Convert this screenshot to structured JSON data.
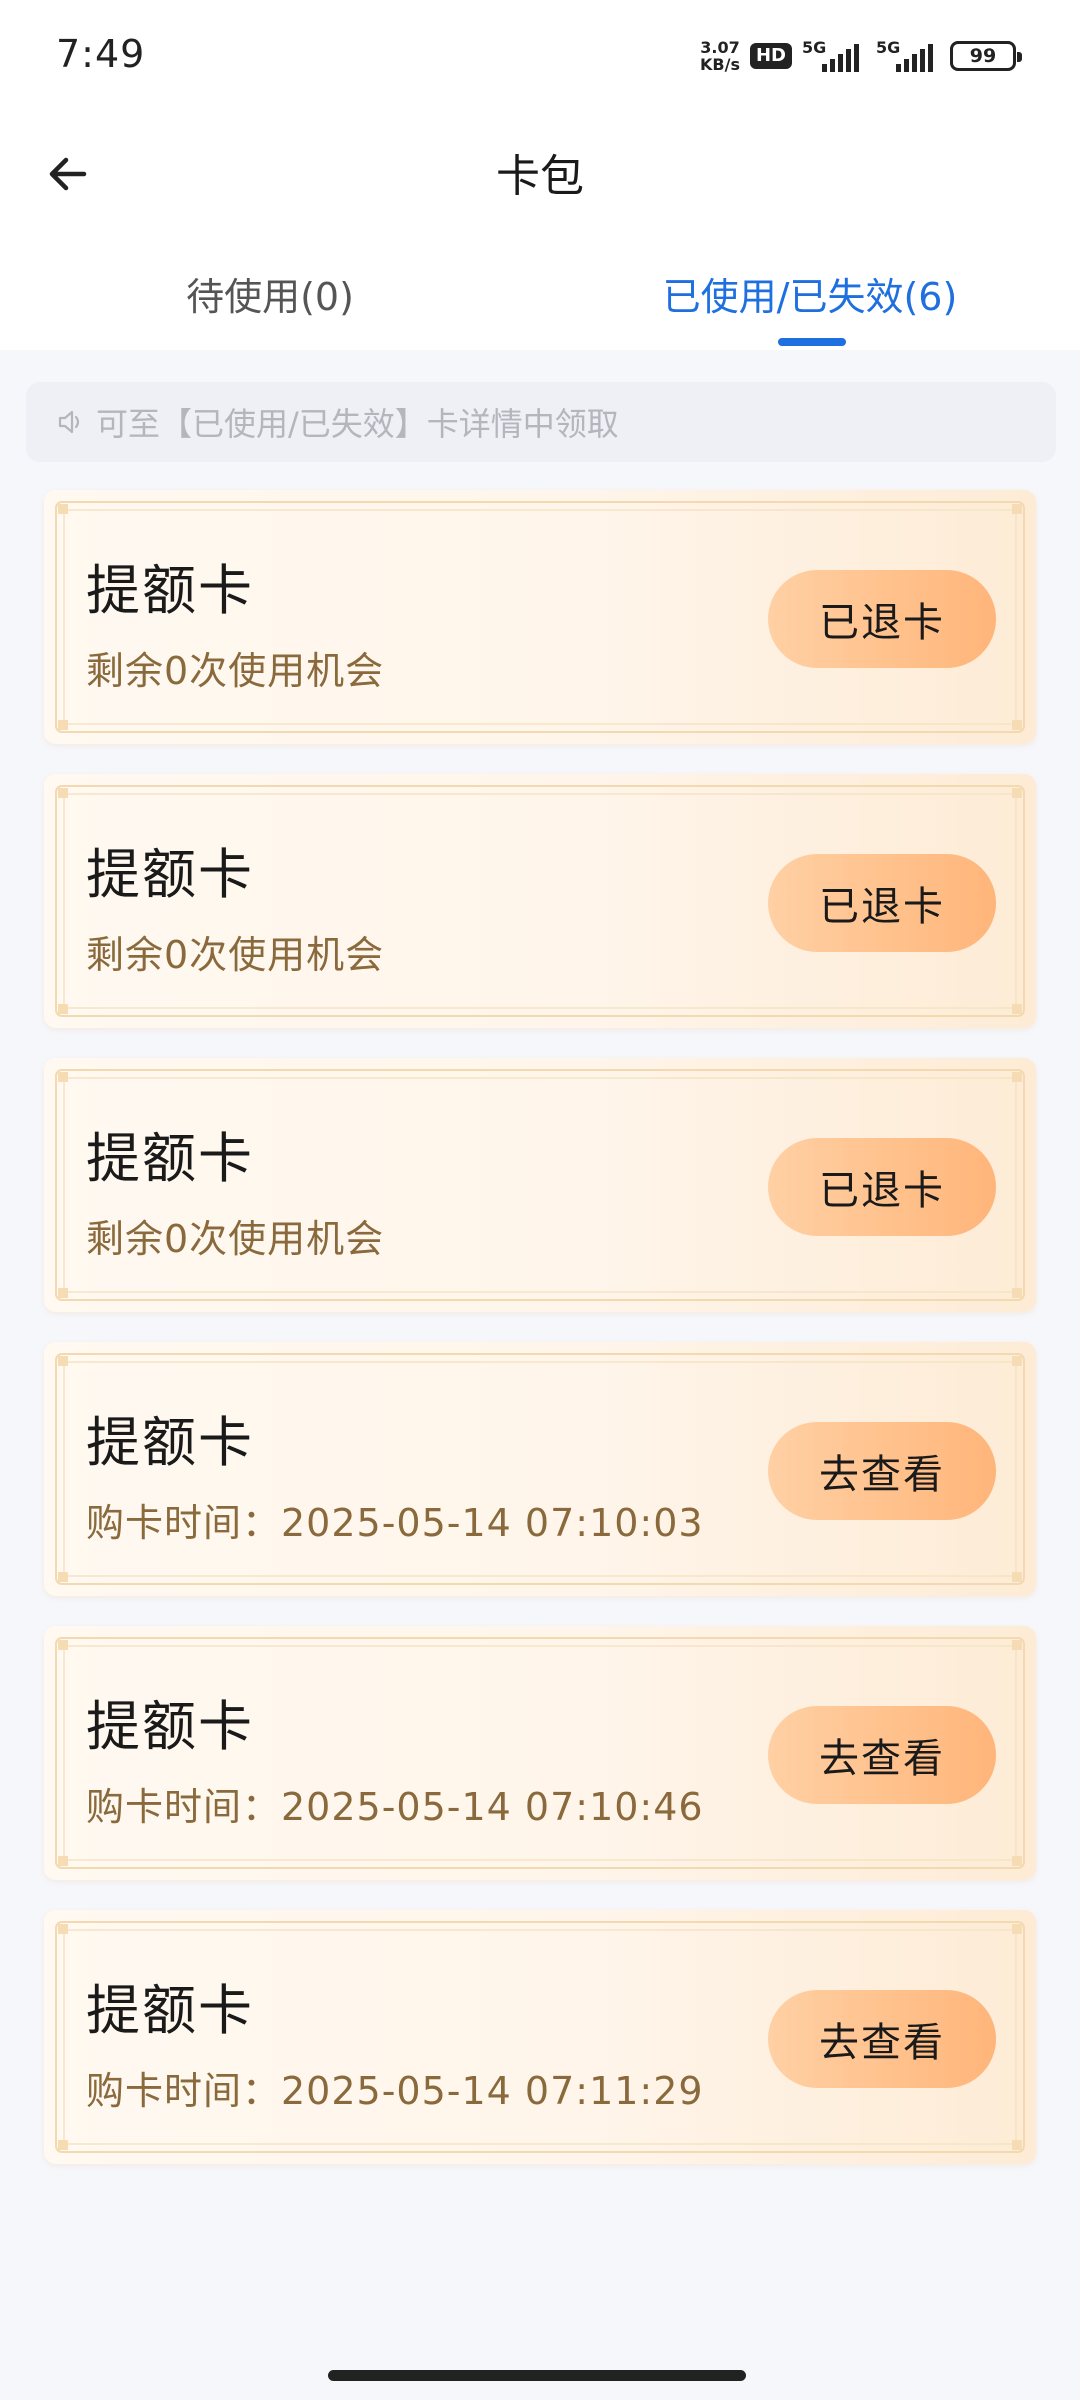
{
  "status_bar": {
    "time": "7:49",
    "net_speed_value": "3.07",
    "net_speed_unit": "KB/s",
    "hd": "HD",
    "sim1": "5G",
    "sim2": "5G",
    "battery": "99"
  },
  "header": {
    "title": "卡包",
    "back_icon": "arrow-left-icon"
  },
  "tabs": [
    {
      "label": "待使用(0)",
      "active": false
    },
    {
      "label": "已使用/已失效(6)",
      "active": true
    }
  ],
  "notice": {
    "icon": "speaker-icon",
    "text": "可至【已使用/已失效】卡详情中领取"
  },
  "cards": [
    {
      "title": "提额卡",
      "subtitle": "剩余0次使用机会",
      "button": "已退卡"
    },
    {
      "title": "提额卡",
      "subtitle": "剩余0次使用机会",
      "button": "已退卡"
    },
    {
      "title": "提额卡",
      "subtitle": "剩余0次使用机会",
      "button": "已退卡"
    },
    {
      "title": "提额卡",
      "subtitle": "购卡时间：2025-05-14 07:10:03",
      "button": "去查看"
    },
    {
      "title": "提额卡",
      "subtitle": "购卡时间：2025-05-14 07:10:46",
      "button": "去查看"
    },
    {
      "title": "提额卡",
      "subtitle": "购卡时间：2025-05-14 07:11:29",
      "button": "去查看"
    }
  ],
  "colors": {
    "accent": "#1e6fe0",
    "card_button": "#ffc08a",
    "subtitle": "#8a6a3c"
  }
}
